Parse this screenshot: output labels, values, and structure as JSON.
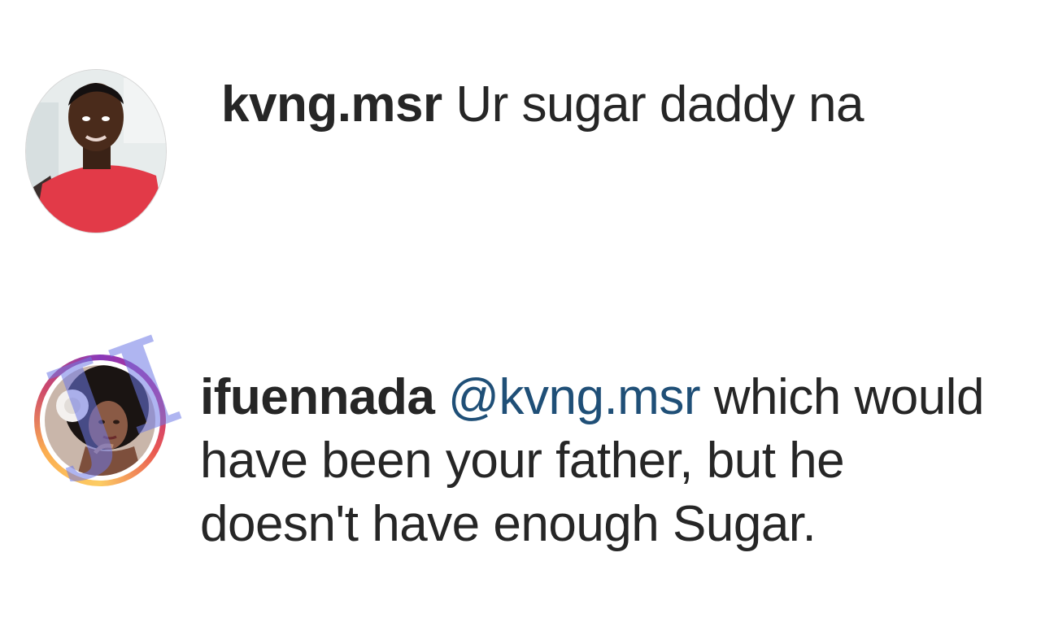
{
  "comments": [
    {
      "username": "kvng.msr",
      "text": "Ur sugar daddy na",
      "mention": "",
      "avatar_icon": "profile-photo-man-red-shirt"
    },
    {
      "username": "ifuennada",
      "mention": "@kvng.msr",
      "text": "which would have been your father,  but he doesn't have enough Sugar.",
      "avatar_icon": "profile-photo-woman-afro-flower",
      "story_ring": true
    }
  ],
  "colors": {
    "text": "#262626",
    "mention": "#1f4f77",
    "watermark": "#6e78e6"
  }
}
